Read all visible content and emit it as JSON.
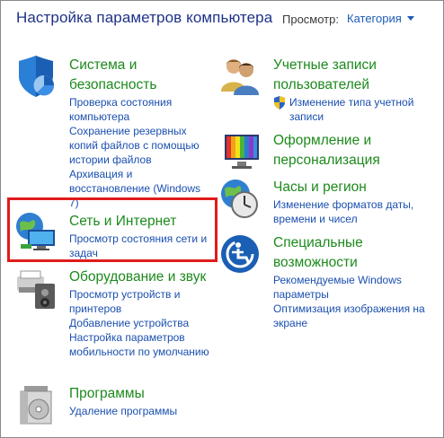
{
  "header": {
    "title": "Настройка параметров компьютера",
    "view_label": "Просмотр:",
    "view_value": "Категория"
  },
  "left_categories": [
    {
      "icon": "shield-pie-icon",
      "title": "Система и безопасность",
      "links": [
        "Проверка состояния компьютера",
        "Сохранение резервных копий файлов с помощью истории файлов",
        "Архивация и восстановление (Windows 7)"
      ]
    },
    {
      "icon": "network-globe-icon",
      "title": "Сеть и Интернет",
      "links": [
        "Просмотр состояния сети и задач"
      ]
    },
    {
      "icon": "printer-speaker-icon",
      "title": "Оборудование и звук",
      "links": [
        "Просмотр устройств и принтеров",
        "Добавление устройства",
        "Настройка параметров мобильности по умолчанию"
      ]
    },
    {
      "icon": "programs-disc-icon",
      "title": "Программы",
      "links": [
        "Удаление программы"
      ]
    }
  ],
  "right_categories": [
    {
      "icon": "users-icon",
      "title": "Учетные записи пользователей",
      "links": [
        "Изменение типа учетной записи"
      ]
    },
    {
      "icon": "display-palette-icon",
      "title": "Оформление и персонализация",
      "links": []
    },
    {
      "icon": "clock-globe-icon",
      "title": "Часы и регион",
      "links": [
        "Изменение форматов даты, времени и чисел"
      ]
    },
    {
      "icon": "accessibility-icon",
      "title": "Специальные возможности",
      "links": [
        "Рекомендуемые Windows параметры",
        "Оптимизация изображения на экране"
      ]
    }
  ],
  "colors": {
    "title": "#1e3287",
    "category": "#1c8a1c",
    "link": "#1a4fb0",
    "highlight": "#e01b1b"
  }
}
